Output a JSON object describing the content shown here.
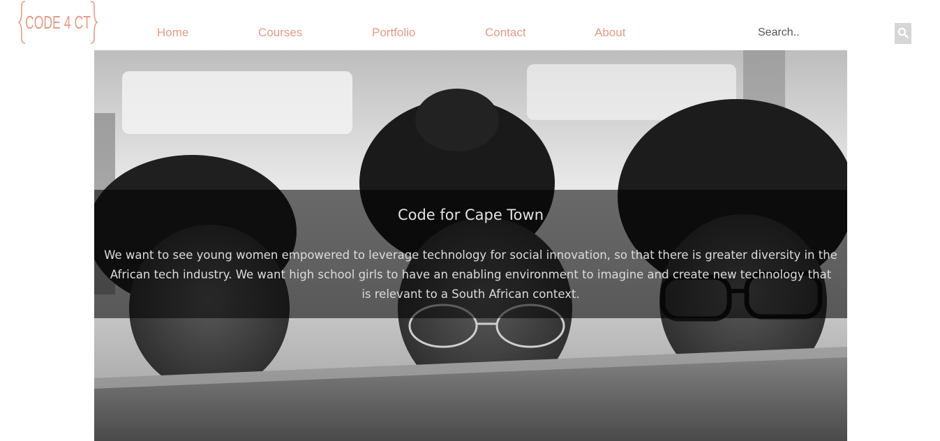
{
  "logo": {
    "text": "CODE 4 CT",
    "color": "#e59a86"
  },
  "nav": {
    "items": [
      {
        "label": "Home"
      },
      {
        "label": "Courses"
      },
      {
        "label": "Portfolio"
      },
      {
        "label": "Contact"
      },
      {
        "label": "About"
      }
    ],
    "link_color": "#e59a86"
  },
  "search": {
    "placeholder": "Search..",
    "icon": "search-icon"
  },
  "hero": {
    "image": "grayscale photo of three young women looking at a computer screen",
    "title": "Code for Cape Town",
    "description": "We want to see young women empowered to leverage technology for social innovation, so that there is greater diversity in the African tech industry. We want high school girls to have an enabling environment to imagine and create new technology that is relevant to a South African context."
  }
}
